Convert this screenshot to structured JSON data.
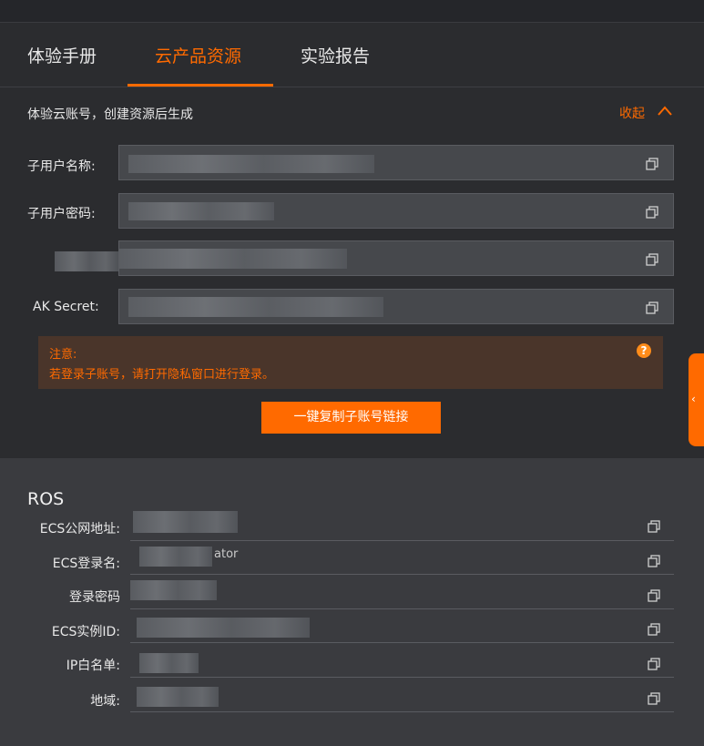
{
  "tabs": [
    {
      "label": "体验手册",
      "active": false
    },
    {
      "label": "云产品资源",
      "active": true
    },
    {
      "label": "实验报告",
      "active": false
    }
  ],
  "account": {
    "title": "体验云账号，创建资源后生成",
    "collapse_label": "收起",
    "fields": [
      {
        "label": "子用户名称:",
        "value": ""
      },
      {
        "label": "子用户密码:",
        "value": ""
      },
      {
        "label": "",
        "value": ""
      },
      {
        "label": "AK Secret:",
        "value": ""
      }
    ],
    "notice": {
      "title": "注意:",
      "text": "若登录子账号，请打开隐私窗口进行登录。",
      "help_icon": "?"
    },
    "copy_button": "一键复制子账号链接"
  },
  "ros": {
    "title": "ROS",
    "rows": [
      {
        "label": "ECS公网地址:",
        "value": ""
      },
      {
        "label": "ECS登录名:",
        "value": "ator"
      },
      {
        "label": "登录密码",
        "value": ""
      },
      {
        "label": "ECS实例ID:",
        "value": ""
      },
      {
        "label": "IP白名单:",
        "value": ""
      },
      {
        "label": "地域:",
        "value": ""
      }
    ]
  },
  "side_tab": {
    "icon": "chevron-left-icon",
    "glyph": "‹"
  },
  "colors": {
    "accent": "#ff6a00",
    "background": "#2b2c2f",
    "ros_background": "#3a3b3f"
  }
}
